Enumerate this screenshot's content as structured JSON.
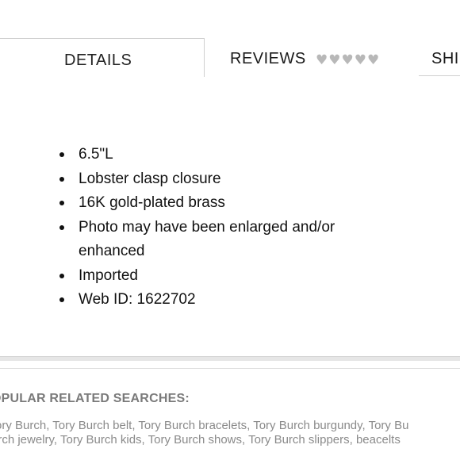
{
  "tabs": {
    "details_label": "DETAILS",
    "reviews_label": "REVIEWS",
    "reviews_hearts": "♥♥♥♥♥",
    "shipping_label": "SHI"
  },
  "details": {
    "items": [
      "6.5\"L",
      "Lobster clasp closure",
      "16K gold-plated brass",
      "Photo may have been enlarged and/or enhanced",
      "Imported",
      "Web ID: 1622702"
    ]
  },
  "related": {
    "title": "OPULAR RELATED SEARCHES:",
    "line1": [
      "ory Burch",
      "Tory Burch belt",
      "Tory Burch bracelets",
      "Tory Burch burgundy",
      "Tory Bu"
    ],
    "line2": [
      "urch jewelry",
      "Tory Burch kids",
      "Tory Burch shows",
      "Tory Burch slippers",
      "beacelts"
    ]
  },
  "colors": {
    "text": "#111111",
    "tab_border": "#cfcfcf",
    "hearts": "#b8b8b8",
    "related_text": "#8a8a8a"
  },
  "icons": {
    "rating": "heart-icon",
    "bullet": "bullet-dot"
  }
}
